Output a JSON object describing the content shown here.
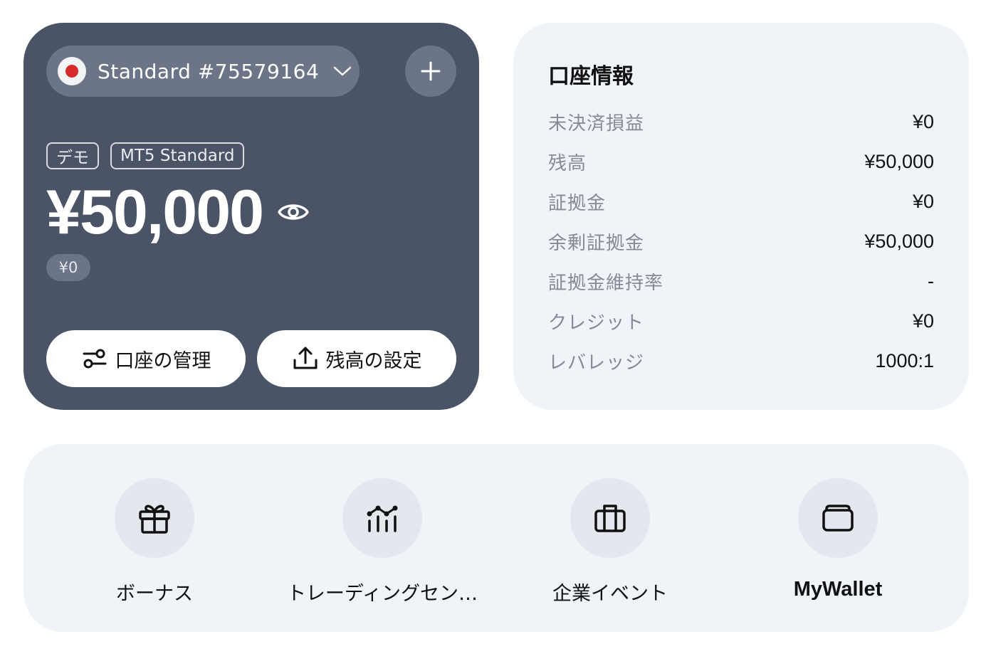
{
  "account": {
    "name": "Standard #75579164",
    "tags": [
      "デモ",
      "MT5 Standard"
    ],
    "balance": "¥50,000",
    "sub_amount": "¥0",
    "manage_label": "口座の管理",
    "set_balance_label": "残高の設定",
    "flag": "japan-flag-icon"
  },
  "info": {
    "title": "口座情報",
    "rows": [
      {
        "label": "未決済損益",
        "value": "¥0"
      },
      {
        "label": "残高",
        "value": "¥50,000"
      },
      {
        "label": "証拠金",
        "value": "¥0"
      },
      {
        "label": "余剰証拠金",
        "value": "¥50,000"
      },
      {
        "label": "証拠金維持率",
        "value": "-"
      },
      {
        "label": "クレジット",
        "value": "¥0"
      },
      {
        "label": "レバレッジ",
        "value": "1000:1"
      }
    ]
  },
  "shortcuts": [
    {
      "label": "ボーナス",
      "icon": "gift-icon"
    },
    {
      "label": "トレーディングセン…",
      "icon": "chart-icon"
    },
    {
      "label": "企業イベント",
      "icon": "briefcase-icon"
    },
    {
      "label": "MyWallet",
      "icon": "wallet-icon"
    }
  ],
  "colors": {
    "card_bg": "#4a5466",
    "panel_bg": "#f0f3f8",
    "flag_red": "#d62b2b"
  }
}
